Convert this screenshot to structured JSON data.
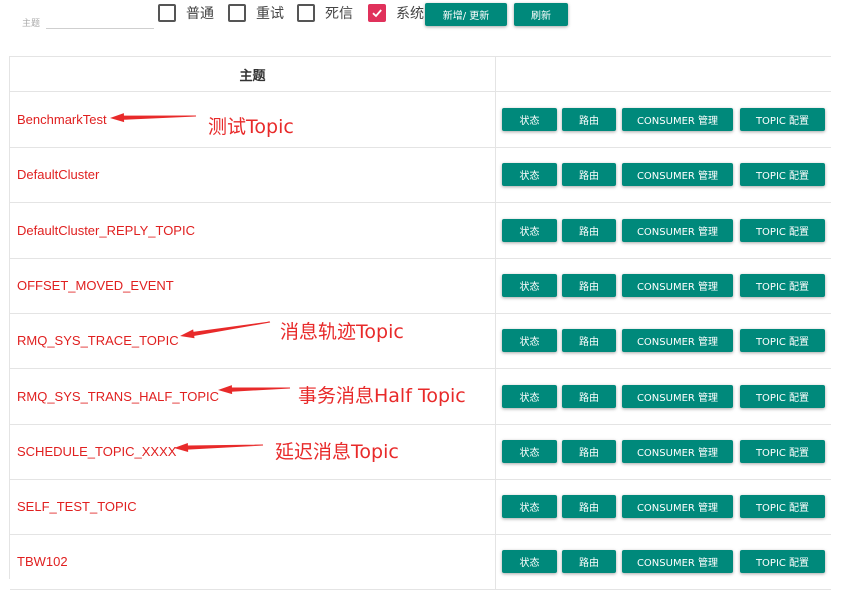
{
  "search": {
    "label": "主题",
    "value": "",
    "placeholder": ""
  },
  "filters": [
    {
      "label": "普通",
      "checked": false
    },
    {
      "label": "重试",
      "checked": false
    },
    {
      "label": "死信",
      "checked": false
    },
    {
      "label": "系统",
      "checked": true
    }
  ],
  "toolbar": {
    "add_update_label": "新增/ 更新",
    "refresh_label": "刷新"
  },
  "table": {
    "header_topic": "主题",
    "header_ops": "",
    "action_labels": {
      "status": "状态",
      "route": "路由",
      "consumer": "CONSUMER 管理",
      "config": "TOPIC 配置"
    },
    "rows": [
      {
        "topic": "BenchmarkTest"
      },
      {
        "topic": "DefaultCluster"
      },
      {
        "topic": "DefaultCluster_REPLY_TOPIC"
      },
      {
        "topic": "OFFSET_MOVED_EVENT"
      },
      {
        "topic": "RMQ_SYS_TRACE_TOPIC"
      },
      {
        "topic": "RMQ_SYS_TRANS_HALF_TOPIC"
      },
      {
        "topic": "SCHEDULE_TOPIC_XXXX"
      },
      {
        "topic": "SELF_TEST_TOPIC"
      },
      {
        "topic": "TBW102"
      }
    ]
  },
  "annotations": [
    {
      "text": "测试Topic",
      "row": 0
    },
    {
      "text": "消息轨迹Topic",
      "row": 4
    },
    {
      "text": "事务消息Half Topic",
      "row": 5
    },
    {
      "text": "延迟消息Topic",
      "row": 6
    }
  ],
  "colors": {
    "accent": "#00897b",
    "topic_text": "#e02020",
    "checkbox_checked": "#e0315b",
    "annotation": "#e82a2a"
  }
}
